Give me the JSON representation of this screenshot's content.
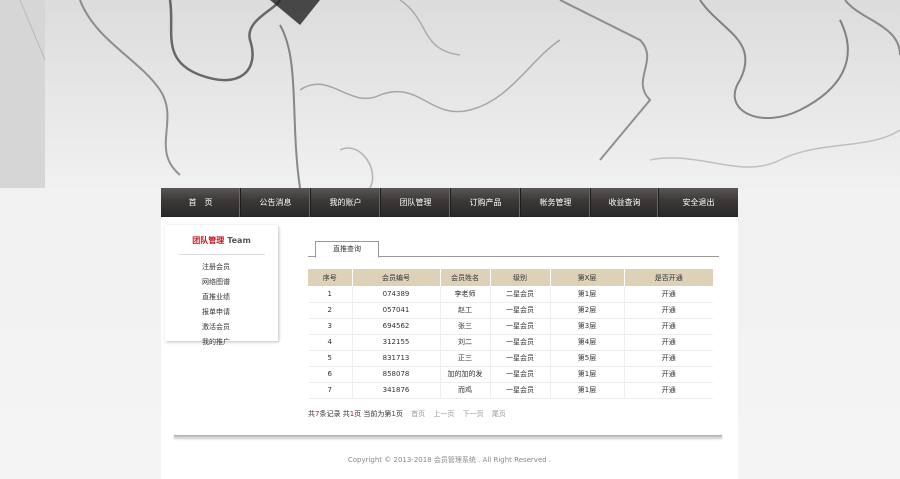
{
  "nav": {
    "items": [
      {
        "label": "首　页"
      },
      {
        "label": "公告消息"
      },
      {
        "label": "我的账户"
      },
      {
        "label": "团队管理"
      },
      {
        "label": "订购产品"
      },
      {
        "label": "帐务管理"
      },
      {
        "label": "收益查询"
      },
      {
        "label": "安全退出"
      }
    ]
  },
  "sidebar": {
    "title_cn": "团队管理",
    "title_en": "Team",
    "items": [
      {
        "label": "注册会员"
      },
      {
        "label": "网络图谱"
      },
      {
        "label": "直推业绩"
      },
      {
        "label": "报单申请"
      },
      {
        "label": "激活会员"
      },
      {
        "label": "我的推广"
      }
    ]
  },
  "main": {
    "tab": "直推查询",
    "table": {
      "headers": [
        "序号",
        "会员编号",
        "会员姓名",
        "级别",
        "第X层",
        "是否开通"
      ],
      "rows": [
        [
          "1",
          "074389",
          "李老师",
          "二星会员",
          "第1层",
          "开通"
        ],
        [
          "2",
          "057041",
          "赵工",
          "一星会员",
          "第2层",
          "开通"
        ],
        [
          "3",
          "694562",
          "张三",
          "一星会员",
          "第3层",
          "开通"
        ],
        [
          "4",
          "312155",
          "刘二",
          "一星会员",
          "第4层",
          "开通"
        ],
        [
          "5",
          "831713",
          "正三",
          "一星会员",
          "第5层",
          "开通"
        ],
        [
          "6",
          "858078",
          "加的加的发",
          "一星会员",
          "第1层",
          "开通"
        ],
        [
          "7",
          "341876",
          "而鸡",
          "一星会员",
          "第1层",
          "开通"
        ]
      ]
    },
    "pager": {
      "prefix": "共",
      "total": "7",
      "records_suffix": "条记录 共",
      "pages": "1",
      "pages_suffix": "页 当前为第",
      "current": "1",
      "current_suffix": "页",
      "first": "首页",
      "prev": "上一页",
      "next": "下一页",
      "last": "尾页"
    }
  },
  "footer": {
    "text": "Copyright © 2013-2018 会员管理系统 . All Right Reserved ."
  },
  "colors": {
    "accent_red": "#c8161d",
    "nav_dark": "#3b3837",
    "table_header": "#ddd2b8"
  }
}
